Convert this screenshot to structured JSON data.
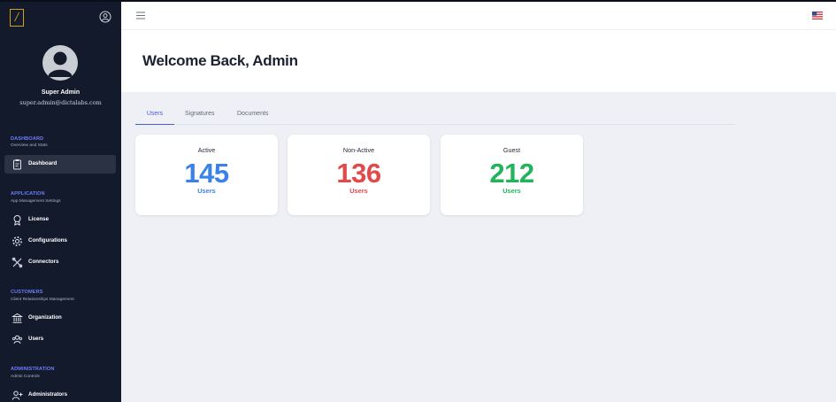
{
  "colors": {
    "sidebar_bg": "#121a2c",
    "accent": "#4a5bd6",
    "section_title": "#6d7df7",
    "logo": "#d4a017",
    "active_value": "#3b82e6",
    "nonactive_value": "#e04a4a",
    "guest_value": "#22b35c"
  },
  "sidebar": {
    "logo_glyph": "/",
    "profile": {
      "name": "Super Admin",
      "email": "super.admin@dictalabs.com"
    },
    "sections": [
      {
        "title": "DASHBOARD",
        "subtitle": "Overview and Stats",
        "items": [
          {
            "label": "Dashboard",
            "icon": "clipboard-icon",
            "active": true
          }
        ]
      },
      {
        "title": "APPLICATION",
        "subtitle": "App Management Settings",
        "items": [
          {
            "label": "License",
            "icon": "award-icon"
          },
          {
            "label": "Configurations",
            "icon": "gear-icon"
          },
          {
            "label": "Connectors",
            "icon": "tools-icon"
          }
        ]
      },
      {
        "title": "CUSTOMERS",
        "subtitle": "Client Relationships Management",
        "items": [
          {
            "label": "Organization",
            "icon": "bank-icon"
          },
          {
            "label": "Users",
            "icon": "users-icon"
          }
        ]
      },
      {
        "title": "ADMINISTRATION",
        "subtitle": "Admin Controls",
        "items": [
          {
            "label": "Administrators",
            "icon": "user-plus-icon"
          }
        ]
      }
    ]
  },
  "header": {
    "menu_icon": "hamburger-icon",
    "language_icon": "us-flag-icon"
  },
  "main": {
    "welcome": "Welcome Back, Admin",
    "tabs": [
      {
        "label": "Users",
        "active": true
      },
      {
        "label": "Signatures"
      },
      {
        "label": "Documents"
      }
    ],
    "cards": [
      {
        "title": "Active",
        "value": "145",
        "unit": "Users"
      },
      {
        "title": "Non-Active",
        "value": "136",
        "unit": "Users"
      },
      {
        "title": "Guest",
        "value": "212",
        "unit": "Users"
      }
    ]
  }
}
